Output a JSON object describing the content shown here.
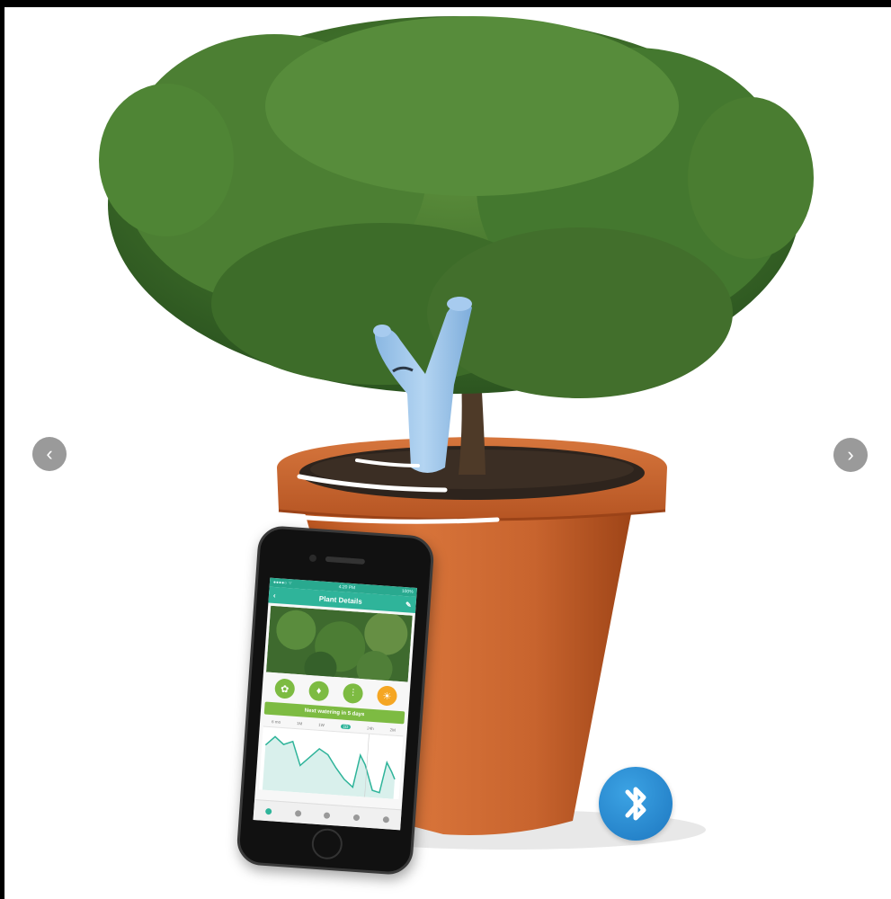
{
  "gallery": {
    "prev_label": "‹",
    "next_label": "›"
  },
  "phone_app": {
    "status_left": "●●●●○ ⌔",
    "status_time": "4:20 PM",
    "status_right": "100%",
    "title": "Plant Details",
    "next_watering": "Next watering in 5 days",
    "range_tabs": [
      "6 mo",
      "1M",
      "1W",
      "1D",
      "24h",
      "2M"
    ],
    "active_range_index": 3
  },
  "colors": {
    "app_teal": "#2fb49a",
    "app_green": "#7dbb42",
    "pot_terracotta": "#c8642e",
    "sensor_blue": "#9ec6ea",
    "bluetooth_blue": "#1d77c0"
  },
  "icons": {
    "prev": "chevron-left-icon",
    "next": "chevron-right-icon",
    "bluetooth": "bluetooth-icon"
  }
}
